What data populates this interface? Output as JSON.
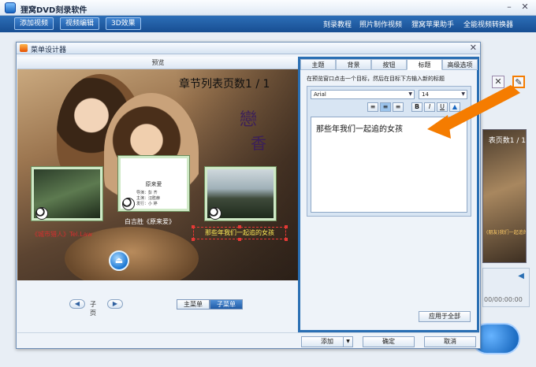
{
  "app": {
    "title": "狸窝DVD刻录软件",
    "minimize": "–",
    "close": "✕"
  },
  "menu": {
    "buttons": [
      "添加视频",
      "视频编辑",
      "3D效果"
    ],
    "links": [
      "刻录教程",
      "照片制作视频",
      "狸窝苹果助手",
      "全能视频转换器"
    ]
  },
  "background": {
    "thumb_title": "表页数1 / 1",
    "thumb_small": "(朋友)我们一起追的女孩",
    "time": "00/00:00:00"
  },
  "dialog": {
    "title": "菜单设计器",
    "close": "✕",
    "preview_header": "预览",
    "chapter_title": "章节列表页数1 / 1",
    "logo_line1": "戀",
    "logo_line2": "香",
    "thumb_doc_title": "原来爱",
    "thumb_doc_lines": [
      "导演：彭 齐",
      "主演：汪胜赫",
      "发行：小 婷"
    ],
    "link_red": "《城市猎人》Tel.Law",
    "link_white": "白吉胜《原来爱》",
    "selected_text": "那些年我们一起追的女孩",
    "disc_icon": "⏏",
    "pager": {
      "prev": "◀",
      "next": "▶",
      "label": "子页"
    },
    "menu_tabs": [
      "主菜单",
      "子菜单"
    ],
    "active_menu_tab": "子菜单"
  },
  "props": {
    "tabs": [
      "主题",
      "背景",
      "按钮",
      "标题",
      "高级选项"
    ],
    "active_tab": "标题",
    "hint": "在预览窗口点击一个目标，然后在目标下方输入新的标题",
    "font": "Arial",
    "size": "14",
    "format_buttons": [
      "≡",
      "≡",
      "≡",
      "B",
      "I",
      "U",
      "▲"
    ],
    "active_format_index": 1,
    "text_value": "那些年我们一起追的女孩",
    "apply_all": "应用于全部"
  },
  "footer": {
    "add": "添加",
    "ok": "确定",
    "cancel": "取消"
  },
  "colors": {
    "menu_bar": "#1f5ba6",
    "panel_border": "#2a6fb3",
    "arrow": "#f57c00",
    "selection": "#e53935",
    "link_red": "#d32f2f"
  },
  "icons": {
    "app_logo": "app-logo-icon",
    "delete": "delete-icon",
    "edit": "edit-icon",
    "disc": "disc-eject-icon",
    "volume": "volume-icon"
  }
}
